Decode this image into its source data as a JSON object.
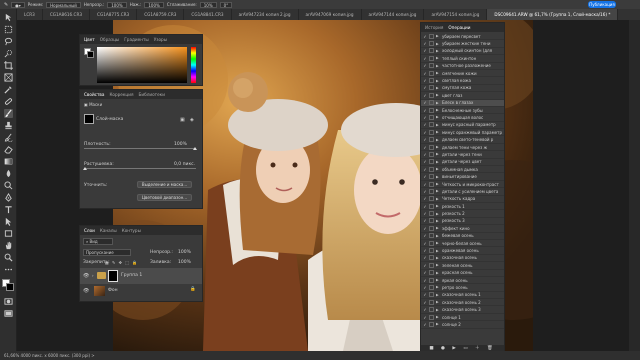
{
  "optbar": {
    "mode_label": "Режим:",
    "mode_value": "Нормальный",
    "opacity_label": "Непрозр.:",
    "opacity_value": "100%",
    "flow_label": "Наж.:",
    "flow_value": "100%",
    "smoothing_label": "Сглаживание:",
    "smoothing_value": "10%",
    "angle_value": "0°",
    "publish_label": "Публикация"
  },
  "tabs": [
    {
      "label": "LCR3",
      "active": false
    },
    {
      "label": "CG1A8616.CR3",
      "active": false
    },
    {
      "label": "CG1A8775.CR3",
      "active": false
    },
    {
      "label": "CG1A8759.CR3",
      "active": false
    },
    {
      "label": "CG1A8841.CR3",
      "active": false
    },
    {
      "label": "arAV947234 копия 2.jpg",
      "active": false
    },
    {
      "label": "arAV947069 копия.jpg",
      "active": false
    },
    {
      "label": "arAV947144 копия.jpg",
      "active": false
    },
    {
      "label": "arAV947154 копия.jpg",
      "active": false
    },
    {
      "label": "DSC09641.ARW @ 61,7% (Группа 1, Слой-маска/16) *",
      "active": true
    }
  ],
  "color_panel": {
    "tabs": [
      "Цвет",
      "Образцы",
      "Градиенты",
      "Узоры"
    ]
  },
  "properties_panel": {
    "tabs": [
      "Свойства",
      "Коррекция",
      "Библиотеки"
    ],
    "section": "Маски",
    "mask_label": "Слой-маска",
    "density_label": "Плотность:",
    "density_value": "100%",
    "feather_label": "Растушевка:",
    "feather_value": "0,0 пикс.",
    "refine_label": "Уточнить:",
    "select_mask_button": "Выделение и маска...",
    "color_range_button": "Цветовой диапазон...",
    "invert_button": "Инвертировать"
  },
  "layers_panel": {
    "tabs": [
      "Слои",
      "Каналы",
      "Контуры"
    ],
    "search_placeholder": "Вид",
    "blend_mode": "Пропускание",
    "opacity_label": "Непрозр.:",
    "opacity_value": "100%",
    "lock_label": "Закрепить:",
    "fill_label": "Заливка:",
    "fill_value": "100%",
    "layers": [
      {
        "name": "Группа 1",
        "visible": true,
        "selected": true
      },
      {
        "name": "Фон",
        "visible": true,
        "selected": false
      }
    ]
  },
  "history_panel": {
    "tabs": [
      "История",
      "Операции"
    ],
    "actions": [
      "убираем пересвет",
      "убираем жесткие тени",
      "холодный скинтон (для",
      "теплый скинтон",
      "частотное разложение",
      "смягчение кожи",
      "светлая кожа",
      "смуглая кожа",
      "цвет глаз",
      "Блеск в глазах",
      "Белоснежные зубы",
      "отчищающая волос",
      "минус красный параметр",
      "минус оранжевый параметр",
      "делаем свето-теневой р",
      "делаем тени через ж",
      "детали через тени",
      "детали через цвет",
      "объемная дымка",
      "виньетирование",
      "Четкость и микроконтраст",
      "детали с усилением цвета",
      "Четкость кадра",
      "резкость 1",
      "резкость 2",
      "резкость 3",
      "эффект кино",
      "бежевая осень",
      "черно-белая осень",
      "оранжевая осень",
      "сказочная осень",
      "зеленая осень",
      "красная осень",
      "яркая осень",
      "ретро осень",
      "сказочная осень 1",
      "сказочная осень 2",
      "сказочная осень 3",
      "солнце 1",
      "солнце 2"
    ]
  },
  "statusbar": {
    "text": "61,66%   4000 пикс. x 6000 пикс. (300 ppi)   >"
  }
}
